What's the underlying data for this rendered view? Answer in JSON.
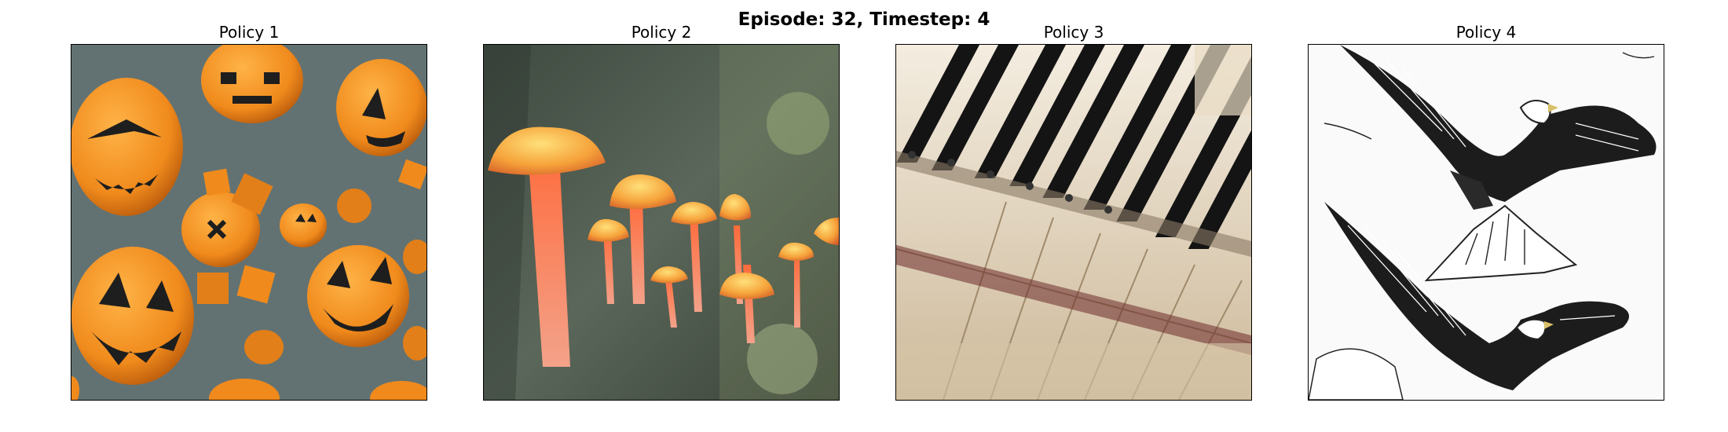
{
  "suptitle": "Episode: 32, Timestep: 4",
  "panels": [
    {
      "title": "Policy 1",
      "image_icon": "halloween-pumpkins-image"
    },
    {
      "title": "Policy 2",
      "image_icon": "glowing-mushrooms-image"
    },
    {
      "title": "Policy 3",
      "image_icon": "piano-keys-image"
    },
    {
      "title": "Policy 4",
      "image_icon": "eagles-sketch-image"
    }
  ],
  "colors": {
    "pumpkin": "#f08a1c",
    "pumpkin_bg": "#5c6d70",
    "mushroom_cap": "#f6a23a",
    "bark": "#4f5a4e",
    "piano_ivory": "#e8dcc3",
    "piano_black": "#141414"
  }
}
